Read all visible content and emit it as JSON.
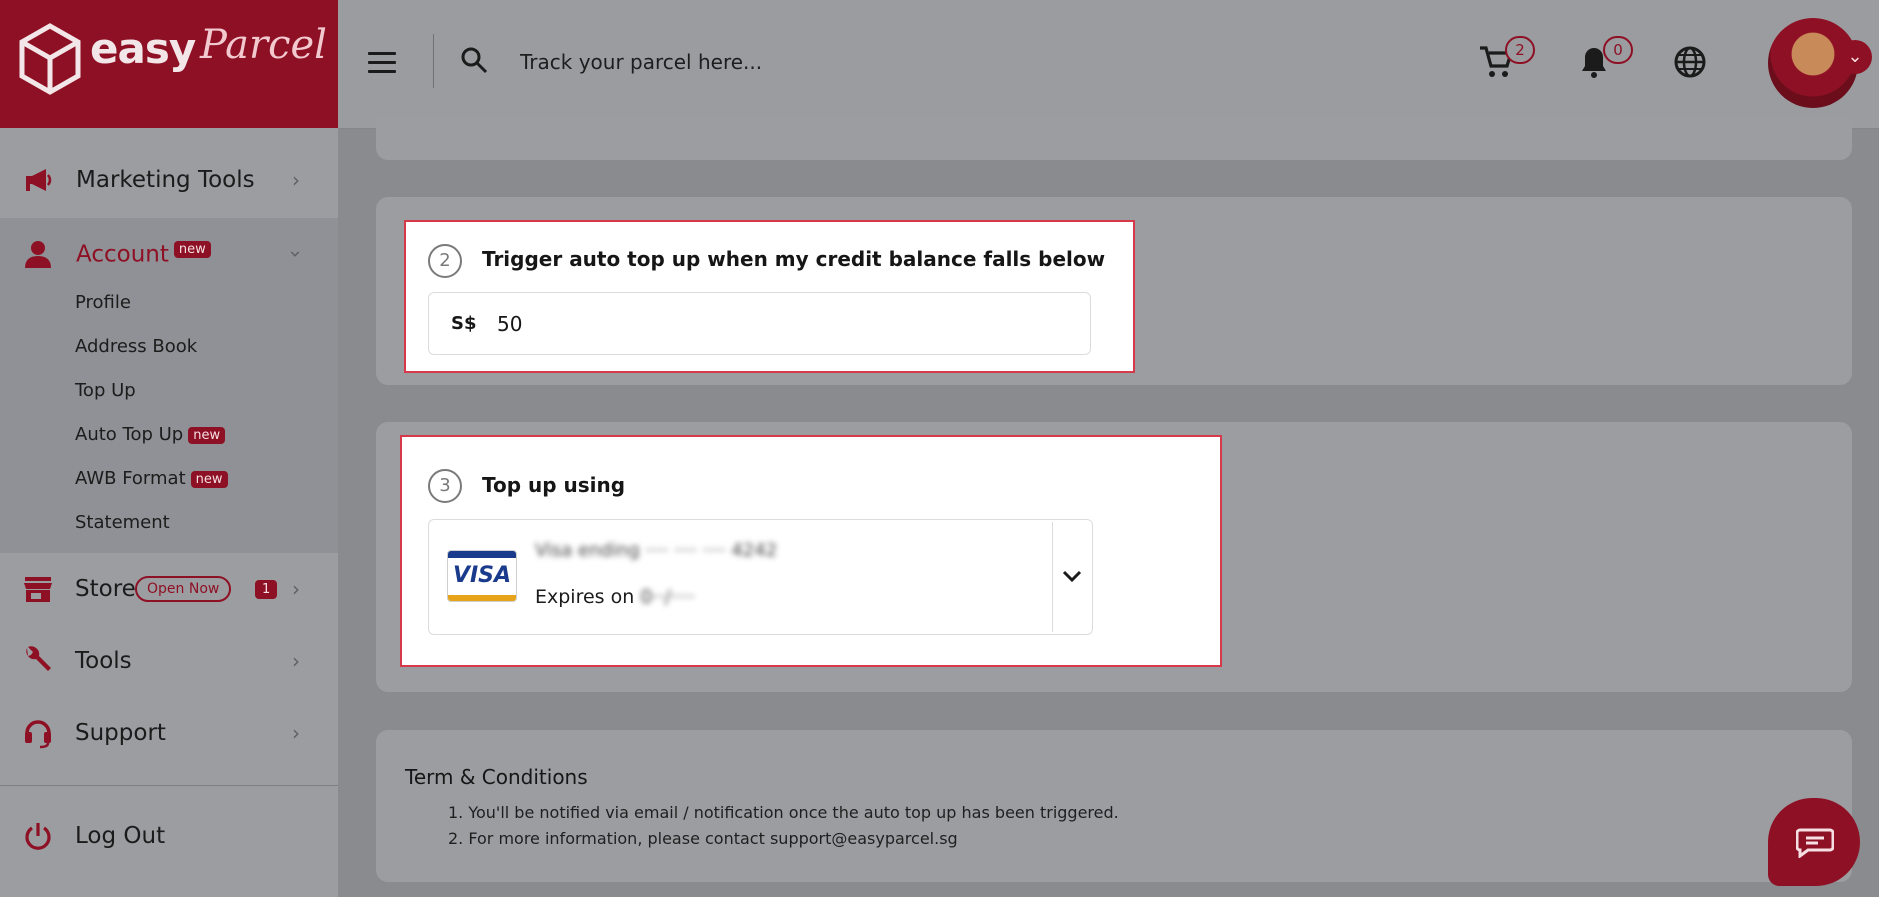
{
  "brand": {
    "name": "easy",
    "script": "Parcel"
  },
  "sidebar": {
    "items": [
      {
        "label": "Marketing Tools"
      },
      {
        "label": "Account",
        "badge": "new"
      },
      {
        "label": "Store",
        "badge": "Open Now",
        "count": "1"
      },
      {
        "label": "Tools"
      },
      {
        "label": "Support"
      }
    ],
    "account_sub": [
      {
        "label": "Profile"
      },
      {
        "label": "Address Book"
      },
      {
        "label": "Top Up"
      },
      {
        "label": "Auto Top Up",
        "badge": "new"
      },
      {
        "label": "AWB Format",
        "badge": "new"
      },
      {
        "label": "Statement"
      }
    ],
    "logout": "Log Out"
  },
  "header": {
    "search_placeholder": "Track your parcel here...",
    "cart_count": "2",
    "notif_count": "0"
  },
  "step2": {
    "num": "2",
    "title": "Trigger auto top up when my credit balance falls below",
    "currency": "S$",
    "amount": "50"
  },
  "step3": {
    "num": "3",
    "title": "Top up using",
    "card_brand": "VISA",
    "card_name": "Visa ending ···· ···· ···· 4242",
    "expires_label": "Expires on",
    "expires_value": "0··/····"
  },
  "terms": {
    "title": "Term & Conditions",
    "lines": [
      "1. You'll be notified via email / notification once the auto top up has been triggered.",
      "2. For more information, please contact support@easyparcel.sg"
    ]
  },
  "colors": {
    "brand": "#8e1024",
    "highlight": "#d63a4a"
  }
}
